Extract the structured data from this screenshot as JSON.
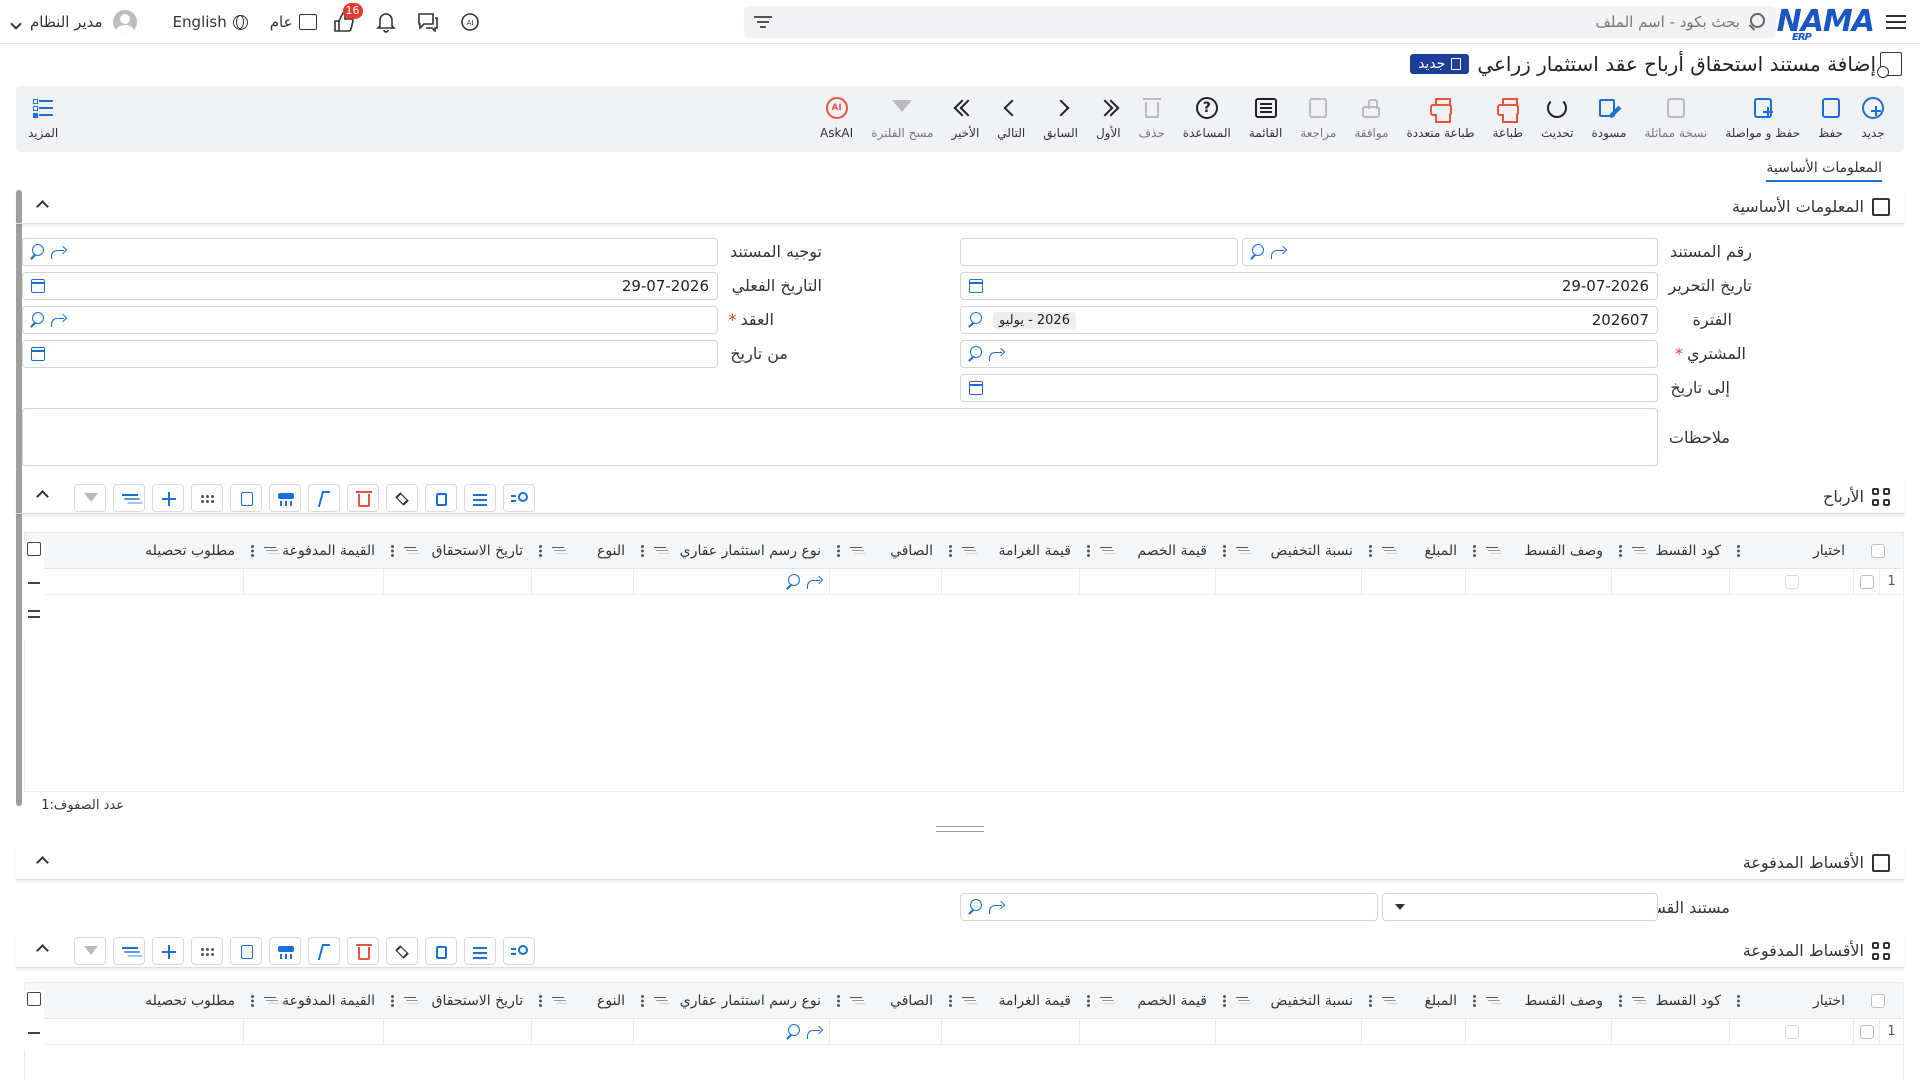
{
  "topbar": {
    "logo": "NAMA",
    "logo_sub": "ERP",
    "search_placeholder": "بحث بكود - اسم الملف",
    "user_name": "مدير النظام",
    "language": "English",
    "public_label": "عام",
    "notification_count": "16"
  },
  "page": {
    "title": "إضافة مستند استحقاق أرباح عقد استثمار زراعي",
    "new_badge": "جديد"
  },
  "toolbar": {
    "buttons": [
      {
        "label": "جديد",
        "icon": "plus-circle-icon"
      },
      {
        "label": "حفظ",
        "icon": "save-icon"
      },
      {
        "label": "حفظ و مواصلة",
        "icon": "save-continue-icon"
      },
      {
        "label": "نسخة مماثلة",
        "icon": "copy-icon"
      },
      {
        "label": "مسودة",
        "icon": "draft-icon"
      },
      {
        "label": "تحديث",
        "icon": "refresh-icon"
      },
      {
        "label": "طباعة",
        "icon": "print-icon"
      },
      {
        "label": "طباعة متعددة",
        "icon": "multi-print-icon"
      },
      {
        "label": "موافقة",
        "icon": "approve-icon"
      },
      {
        "label": "مراجعة",
        "icon": "review-icon"
      },
      {
        "label": "القائمة",
        "icon": "list-icon"
      },
      {
        "label": "المساعدة",
        "icon": "help-icon"
      },
      {
        "label": "حذف",
        "icon": "delete-icon"
      },
      {
        "label": "الأول",
        "icon": "first-icon"
      },
      {
        "label": "السابق",
        "icon": "previous-icon"
      },
      {
        "label": "التالي",
        "icon": "next-icon"
      },
      {
        "label": "الأخير",
        "icon": "last-icon"
      },
      {
        "label": "مسح الفلترة",
        "icon": "clear-filter-icon"
      },
      {
        "label": "AskAI",
        "icon": "ai-icon"
      }
    ],
    "more_label": "المزيد"
  },
  "tabs": {
    "active": "المعلومات الأساسية"
  },
  "basic_info": {
    "section_title": "المعلومات الأساسية",
    "doc_number_label": "رقم المستند",
    "doc_number_value": "",
    "doc_routing_label": "توجيه المستند",
    "doc_routing_value": "",
    "edit_date_label": "تاريخ التحرير",
    "edit_date_value": "29-07-2026",
    "actual_date_label": "التاريخ الفعلي",
    "actual_date_value": "29-07-2026",
    "period_label": "الفترة",
    "period_value": "202607",
    "period_chip": "2026 - يوليو",
    "contract_label": "العقد",
    "contract_value": "",
    "buyer_label": "المشتري",
    "buyer_value": "",
    "from_date_label": "من تاريخ",
    "from_date_value": "",
    "to_date_label": "إلى تاريخ",
    "to_date_value": "",
    "notes_label": "ملاحظات",
    "notes_value": ""
  },
  "profits": {
    "section_title": "الأرباح",
    "columns": [
      "اختيار",
      "كود القسط",
      "وصف القسط",
      "المبلغ",
      "نسبة التخفيض",
      "قيمة الخصم",
      "قيمة الغرامة",
      "الصافي",
      "نوع رسم استثمار عقاري",
      "النوع",
      "تاريخ الاستحقاق",
      "القيمة المدفوعة",
      "مطلوب تحصيله"
    ],
    "rows": [
      {
        "index": "1"
      }
    ],
    "row_count_label": "عدد الصفوف:",
    "row_count_value": "1"
  },
  "paid_installments": {
    "section_title": "الأقساط المدفوعة",
    "installment_doc_label": "مستند القسط",
    "installment_doc_value": "",
    "grid_title": "الأقساط المدفوعة",
    "columns": [
      "اختيار",
      "كود القسط",
      "وصف القسط",
      "المبلغ",
      "نسبة التخفيض",
      "قيمة الخصم",
      "قيمة الغرامة",
      "الصافي",
      "نوع رسم استثمار عقاري",
      "النوع",
      "تاريخ الاستحقاق",
      "القيمة المدفوعة",
      "مطلوب تحصيله"
    ],
    "rows": [
      {
        "index": "1"
      }
    ]
  },
  "colors": {
    "accent": "#1a6fd6",
    "brand": "#1a56c4",
    "orange": "#e8553d",
    "badge_red": "#e53935",
    "new_badge_bg": "#1d3f9b"
  }
}
